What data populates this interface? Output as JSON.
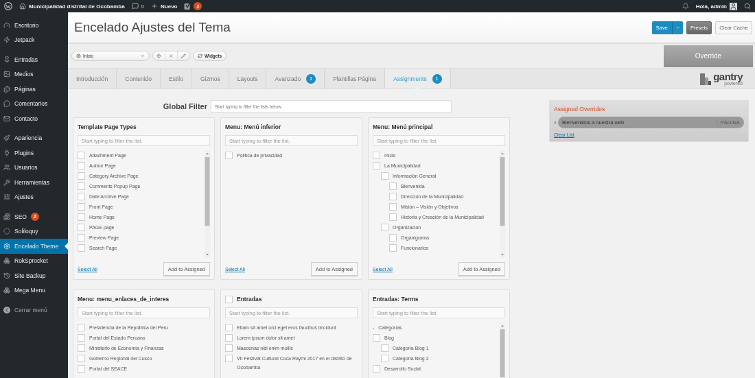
{
  "admin_bar": {
    "site_name": "Municipalidad distrital de Ocobamba",
    "comments_count": "0",
    "new_label": "Nuevo",
    "seo_badge": "2",
    "greeting": "Hola, admin"
  },
  "sidebar": {
    "groups": [
      [
        {
          "label": "Escritorio",
          "selected": false
        },
        {
          "label": "Jetpack",
          "selected": false
        }
      ],
      [
        {
          "label": "Entradas",
          "selected": false
        },
        {
          "label": "Medios",
          "selected": false
        },
        {
          "label": "Páginas",
          "selected": false
        },
        {
          "label": "Comentarios",
          "selected": false
        },
        {
          "label": "Contacto",
          "selected": false
        }
      ],
      [
        {
          "label": "Apariencia",
          "selected": false
        },
        {
          "label": "Plugins",
          "selected": false
        },
        {
          "label": "Usuarios",
          "selected": false
        },
        {
          "label": "Herramientas",
          "selected": false
        },
        {
          "label": "Ajustes",
          "selected": false
        }
      ],
      [
        {
          "label": "SEO",
          "selected": false,
          "badge": "2"
        },
        {
          "label": "Soliloquy",
          "selected": false
        },
        {
          "label": "Encelado Theme",
          "selected": true
        },
        {
          "label": "RokSprocket",
          "selected": false
        },
        {
          "label": "Site Backup",
          "selected": false
        },
        {
          "label": "Mega Menu",
          "selected": false
        }
      ]
    ],
    "collapse_label": "Cerrar menú"
  },
  "header": {
    "title": "Encelado Ajustes del Tema",
    "buttons": {
      "save": "Save",
      "presets": "Presets",
      "clear_cache": "Clear Cache"
    }
  },
  "toolbar": {
    "override_select": "Inicio",
    "widgets_button": "Widgets",
    "override_label": "Override"
  },
  "tabs": [
    {
      "label": "Introducción",
      "selected": false
    },
    {
      "label": "Contenido",
      "selected": false
    },
    {
      "label": "Estilo",
      "selected": false
    },
    {
      "label": "Gizmos",
      "selected": false
    },
    {
      "label": "Layouts",
      "selected": false
    },
    {
      "label": "Avanzado",
      "selected": false,
      "badge": "1"
    },
    {
      "label": "Plantillas Página",
      "selected": false
    },
    {
      "label": "Assignments",
      "selected": true,
      "badge": "1"
    }
  ],
  "logo": {
    "wordmark": "gantry",
    "tagline": "powered"
  },
  "global_filter": {
    "label": "Global Filter",
    "placeholder": "Start typing to filter the lists below"
  },
  "panels": [
    {
      "title": "Template Page Types",
      "placeholder": "Start typing to filter the list.",
      "scrollbar": true,
      "select_all": "Select All",
      "add_button": "Add to Assigned",
      "items": [
        {
          "label": "Attachment Page",
          "checked": false
        },
        {
          "label": "Author Page",
          "checked": false
        },
        {
          "label": "Category Archive Page",
          "checked": false
        },
        {
          "label": "Comments Popup Page",
          "checked": false
        },
        {
          "label": "Date Archive Page",
          "checked": false
        },
        {
          "label": "Front Page",
          "checked": false
        },
        {
          "label": "Home Page",
          "checked": false
        },
        {
          "label": "PAGE page",
          "checked": false
        },
        {
          "label": "Preview Page",
          "checked": false
        },
        {
          "label": "Search Page",
          "checked": false
        }
      ]
    },
    {
      "title": "Menu: Menú inferior",
      "placeholder": "Start typing to filter the list.",
      "scrollbar": false,
      "select_all": "Select All",
      "add_button": "Add to Assigned",
      "items": [
        {
          "label": "Politica de privacidad",
          "checked": false
        }
      ]
    },
    {
      "title": "Menu: Menú principal",
      "placeholder": "Start typing to filter the list.",
      "scrollbar": true,
      "select_all": "Select All",
      "add_button": "Add to Assigned",
      "items": [
        {
          "label": "Inicio",
          "checked": false
        },
        {
          "label": "La Municipalidad",
          "checked": false,
          "children": [
            {
              "label": "Información General",
              "checked": false,
              "children": [
                {
                  "label": "Bienvenida",
                  "checked": false
                },
                {
                  "label": "Dirección de la Municipalidad",
                  "checked": false
                },
                {
                  "label": "Misión – Visión y Objetivos",
                  "checked": false
                },
                {
                  "label": "Historia y Creación de la Municipalidad",
                  "checked": false
                }
              ]
            },
            {
              "label": "Organización",
              "checked": false,
              "children": [
                {
                  "label": "Organigrama",
                  "checked": false
                },
                {
                  "label": "Funcionarios",
                  "checked": false
                }
              ]
            }
          ]
        }
      ]
    },
    {
      "title": "Menu: menu_enlaces_de_interes",
      "placeholder": "Start typing to filter the list.",
      "scrollbar": false,
      "items": [
        {
          "label": "Presidencia de la República del Peru",
          "checked": false
        },
        {
          "label": "Portal del Estado Peruano",
          "checked": false
        },
        {
          "label": "Ministerio de Economia y Finanzas",
          "checked": false
        },
        {
          "label": "Gobierno Regional del Cusco",
          "checked": false
        },
        {
          "label": "Portal del SEACE",
          "checked": false
        }
      ]
    },
    {
      "title": "Entradas",
      "title_checked": false,
      "placeholder": "Start typing to filter the list.",
      "scrollbar": false,
      "items": [
        {
          "label": "Etiam sit amet orci eget eros faucibus tincidunt",
          "checked": false
        },
        {
          "label": "Lorem ipsum dolor sit amet",
          "checked": false
        },
        {
          "label": "Maecenas nisi enim mollis",
          "checked": false
        },
        {
          "label": "VII Festival Cultural Coca Raymi 2017 en el distrito de Ocobamba",
          "checked": false
        }
      ]
    },
    {
      "title": "Entradas: Terms",
      "placeholder": "Start typing to filter the list.",
      "scrollbar": true,
      "items": [
        {
          "kind": "group",
          "toggle": "-",
          "label": "Categorías",
          "children": [
            {
              "label": "Blog",
              "checked": false,
              "children": [
                {
                  "label": "Categoría Blog 1",
                  "checked": false
                },
                {
                  "label": "Categoría Blog 2",
                  "checked": false
                }
              ]
            },
            {
              "label": "Desarrollo Social",
              "checked": false
            }
          ]
        }
      ]
    }
  ],
  "assigned": {
    "title": "Assigned Overrides",
    "items": [
      {
        "remove": "×",
        "label": "Bienvenidos a nuestra web",
        "type": "PÁGINA"
      }
    ],
    "clear_link": "Clear List"
  }
}
